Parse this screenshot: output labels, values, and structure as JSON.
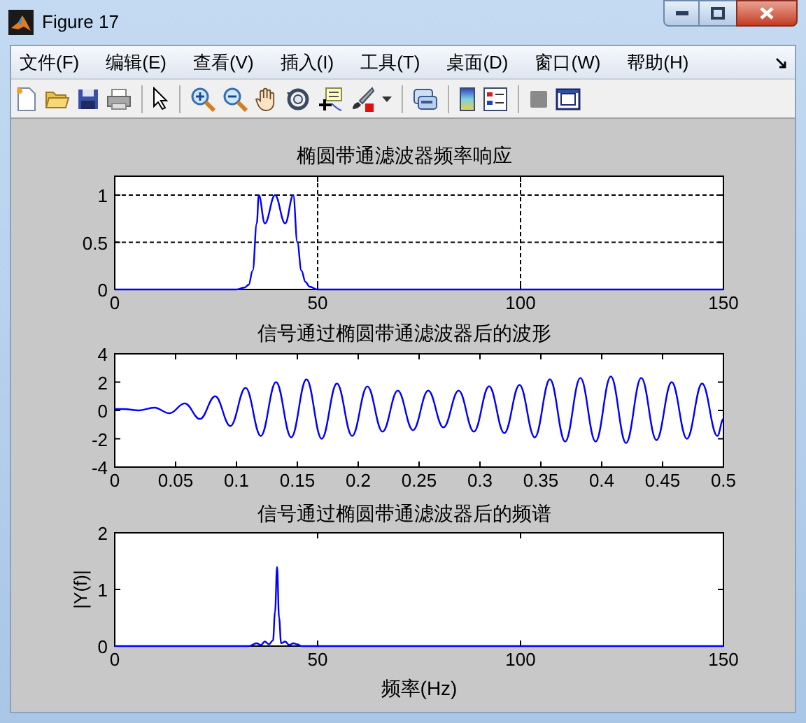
{
  "window": {
    "title": "Figure 17"
  },
  "menu": [
    "文件(F)",
    "编辑(E)",
    "查看(V)",
    "插入(I)",
    "工具(T)",
    "桌面(D)",
    "窗口(W)",
    "帮助(H)"
  ],
  "plots": [
    {
      "chart_data": {
        "type": "line",
        "title": "椭圆带通滤波器频率响应",
        "xlim": [
          0,
          150
        ],
        "ylim": [
          0,
          1.2
        ],
        "xticks": [
          0,
          50,
          100,
          150
        ],
        "yticks": [
          0,
          0.5,
          1
        ],
        "grid": true,
        "x": [
          0,
          30,
          32,
          33,
          34,
          35,
          35.5,
          37,
          39.5,
          42,
          44,
          45,
          46,
          47,
          48,
          50,
          150
        ],
        "series": [
          {
            "color": "#0000ff",
            "values": [
              0,
              0,
              0.02,
              0.05,
              0.2,
              0.7,
              1,
              0.7,
              1,
              0.7,
              1,
              0.5,
              0.2,
              0.08,
              0.03,
              0,
              0
            ]
          }
        ]
      }
    },
    {
      "chart_data": {
        "type": "line",
        "title": "信号通过椭圆带通滤波器后的波形",
        "xlim": [
          0,
          0.5
        ],
        "ylim": [
          -4,
          4
        ],
        "xticks": [
          0,
          0.05,
          0.1,
          0.15,
          0.2,
          0.25,
          0.3,
          0.35,
          0.4,
          0.45,
          0.5
        ],
        "yticks": [
          -4,
          -2,
          0,
          2,
          4
        ],
        "grid": false,
        "x": [
          0,
          0.0075,
          0.02,
          0.0325,
          0.045,
          0.0575,
          0.07,
          0.0825,
          0.095,
          0.1075,
          0.12,
          0.1325,
          0.145,
          0.1575,
          0.17,
          0.1825,
          0.195,
          0.2075,
          0.22,
          0.2325,
          0.245,
          0.2575,
          0.27,
          0.2825,
          0.295,
          0.3075,
          0.32,
          0.3325,
          0.345,
          0.3575,
          0.37,
          0.3825,
          0.395,
          0.4075,
          0.42,
          0.4325,
          0.445,
          0.4575,
          0.47,
          0.4825,
          0.495,
          0.5
        ],
        "series": [
          {
            "color": "#0000ff",
            "values": [
              0.1,
              0.1,
              0,
              0.2,
              -0.2,
              0.5,
              -0.6,
              1,
              -1.1,
              1.6,
              -1.8,
              2,
              -1.9,
              2.2,
              -2,
              1.9,
              -1.8,
              1.7,
              -1.5,
              1.4,
              -1.4,
              1.4,
              -1.2,
              1.4,
              -1.5,
              1.7,
              -1.6,
              1.8,
              -1.9,
              2.2,
              -2.2,
              2.3,
              -2.2,
              2.4,
              -2.3,
              2.3,
              -2.1,
              2,
              -2,
              1.9,
              -1.8,
              -0.6
            ]
          }
        ]
      }
    },
    {
      "chart_data": {
        "type": "line",
        "title": "信号通过椭圆带通滤波器后的频谱",
        "xlabel": "频率(Hz)",
        "ylabel": "|Y(f)|",
        "xlim": [
          0,
          150
        ],
        "ylim": [
          0,
          2
        ],
        "xticks": [
          0,
          50,
          100,
          150
        ],
        "yticks": [
          0,
          1,
          2
        ],
        "grid": false,
        "x": [
          0,
          33,
          35,
          36,
          37,
          38,
          39,
          39.5,
          40,
          40.5,
          41,
          42,
          43,
          44,
          45,
          46,
          150
        ],
        "series": [
          {
            "color": "#0000ff",
            "values": [
              0,
              0,
              0.05,
              0.02,
              0.08,
              0.03,
              0.1,
              0.6,
              1.4,
              0.5,
              0.05,
              0.08,
              0.02,
              0.05,
              0.03,
              0,
              0
            ]
          }
        ]
      }
    }
  ]
}
